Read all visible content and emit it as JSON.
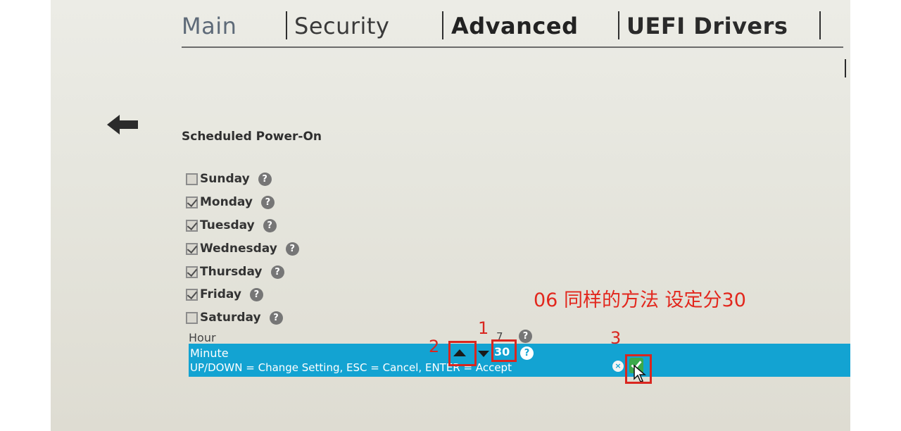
{
  "tabs": [
    {
      "label": "Main"
    },
    {
      "label": "Security"
    },
    {
      "label": "Advanced"
    },
    {
      "label": "UEFI Drivers"
    }
  ],
  "section_title": "Scheduled Power-On",
  "days": [
    {
      "label": "Sunday",
      "checked": false
    },
    {
      "label": "Monday",
      "checked": true
    },
    {
      "label": "Tuesday",
      "checked": true
    },
    {
      "label": "Wednesday",
      "checked": true
    },
    {
      "label": "Thursday",
      "checked": true
    },
    {
      "label": "Friday",
      "checked": true
    },
    {
      "label": "Saturday",
      "checked": false
    }
  ],
  "help_glyph": "?",
  "hour": {
    "label": "Hour",
    "value": "7"
  },
  "minute": {
    "label": "Minute",
    "value": "30"
  },
  "hint": "UP/DOWN = Change Setting,  ESC = Cancel, ENTER = Accept",
  "cancel_glyph": "×",
  "annotations": {
    "instruction": "06 同样的方法 设定分30",
    "step1": "1",
    "step2": "2",
    "step3": "3"
  },
  "colors": {
    "highlight": "#13a3d2",
    "annotation_red": "#d9261f",
    "accept_green": "#3aa94a"
  },
  "icons": [
    "back-arrow-icon",
    "help-icon",
    "up-arrow-icon",
    "down-arrow-icon",
    "cancel-icon",
    "accept-check-icon",
    "mouse-cursor-icon"
  ]
}
